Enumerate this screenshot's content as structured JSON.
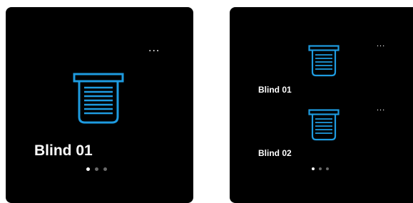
{
  "colors": {
    "background": "#ffffff",
    "panel": "#000000",
    "text": "#ffffff",
    "accent": "#1e9be0",
    "dot_active": "#ffffff",
    "dot_inactive": "#6a6a6a"
  },
  "left_panel": {
    "menu_label": "...",
    "blind": {
      "icon": "blind-icon",
      "label": "Blind 01"
    },
    "pagination": {
      "pages": 3,
      "active": 0
    }
  },
  "right_panel": {
    "items": [
      {
        "icon": "blind-icon",
        "label": "Blind 01",
        "menu_label": "..."
      },
      {
        "icon": "blind-icon",
        "label": "Blind 02",
        "menu_label": "..."
      }
    ],
    "pagination": {
      "pages": 3,
      "active": 0
    }
  }
}
